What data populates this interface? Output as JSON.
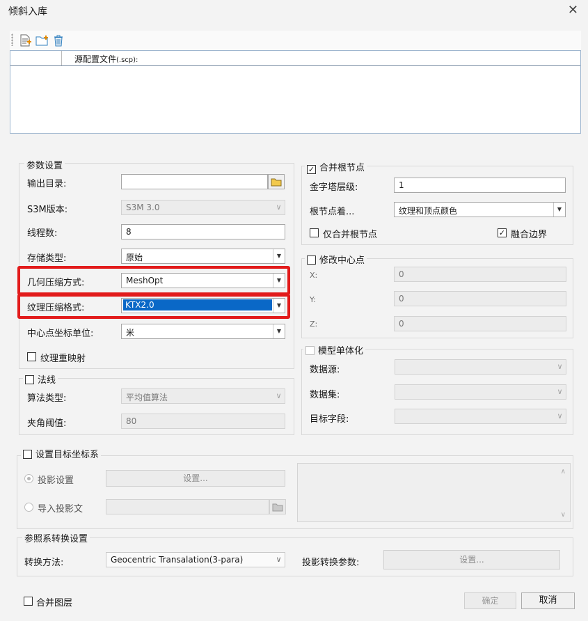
{
  "window": {
    "title": "倾斜入库",
    "close_glyph": "✕"
  },
  "toolbar": {
    "icons": [
      "new-file-icon",
      "new-folder-icon",
      "delete-icon"
    ]
  },
  "file_table": {
    "column": "源配置文件",
    "column_suffix": "(.scp):"
  },
  "params": {
    "group_title": "参数设置",
    "output_dir": {
      "label": "输出目录:",
      "value": ""
    },
    "s3m_version": {
      "label": "S3M版本:",
      "value": "S3M 3.0"
    },
    "threads": {
      "label": "线程数:",
      "value": "8"
    },
    "storage_type": {
      "label": "存储类型:",
      "value": "原始"
    },
    "geometry_compression": {
      "label": "几何压缩方式:",
      "value": "MeshOpt"
    },
    "texture_compression": {
      "label": "纹理压缩格式:",
      "value": "KTX2.0"
    },
    "center_unit": {
      "label": "中心点坐标单位:",
      "value": "米"
    },
    "texture_remap": {
      "label": "纹理重映射",
      "checked": false
    }
  },
  "normals": {
    "group_title": "法线",
    "checked": false,
    "algorithm": {
      "label": "算法类型:",
      "value": "平均值算法"
    },
    "angle": {
      "label": "夹角阈值:",
      "value": "80"
    }
  },
  "merge_root": {
    "group_title": "合并根节点",
    "checked": true,
    "pyramid_level": {
      "label": "金字塔层级:",
      "value": "1"
    },
    "root_color": {
      "label": "根节点着...",
      "value": "纹理和顶点颜色"
    },
    "only_merge_root": {
      "label": "仅合并根节点",
      "checked": false
    },
    "merge_boundary": {
      "label": "融合边界",
      "checked": true
    }
  },
  "center_point": {
    "group_title": "修改中心点",
    "checked": false,
    "x": {
      "label": "X:",
      "value": "0"
    },
    "y": {
      "label": "Y:",
      "value": "0"
    },
    "z": {
      "label": "Z:",
      "value": "0"
    }
  },
  "model_individual": {
    "group_title": "模型单体化",
    "checked": false,
    "datasource": {
      "label": "数据源:",
      "value": ""
    },
    "dataset": {
      "label": "数据集:",
      "value": ""
    },
    "target_field": {
      "label": "目标字段:",
      "value": ""
    }
  },
  "target_crs": {
    "group_title": "设置目标坐标系",
    "checked": false,
    "projection_setting": {
      "label": "投影设置",
      "button": "设置...",
      "selected": true
    },
    "import_projection": {
      "label": "导入投影文",
      "value": ""
    }
  },
  "transform": {
    "group_title": "参照系转换设置",
    "method": {
      "label": "转换方法:",
      "value": "Geocentric Transalation(3-para)"
    },
    "params": {
      "label": "投影转换参数:",
      "button": "设置..."
    }
  },
  "footer": {
    "merge_layers": {
      "label": "合并图层",
      "checked": false
    },
    "ok": "确定",
    "cancel": "取消"
  }
}
